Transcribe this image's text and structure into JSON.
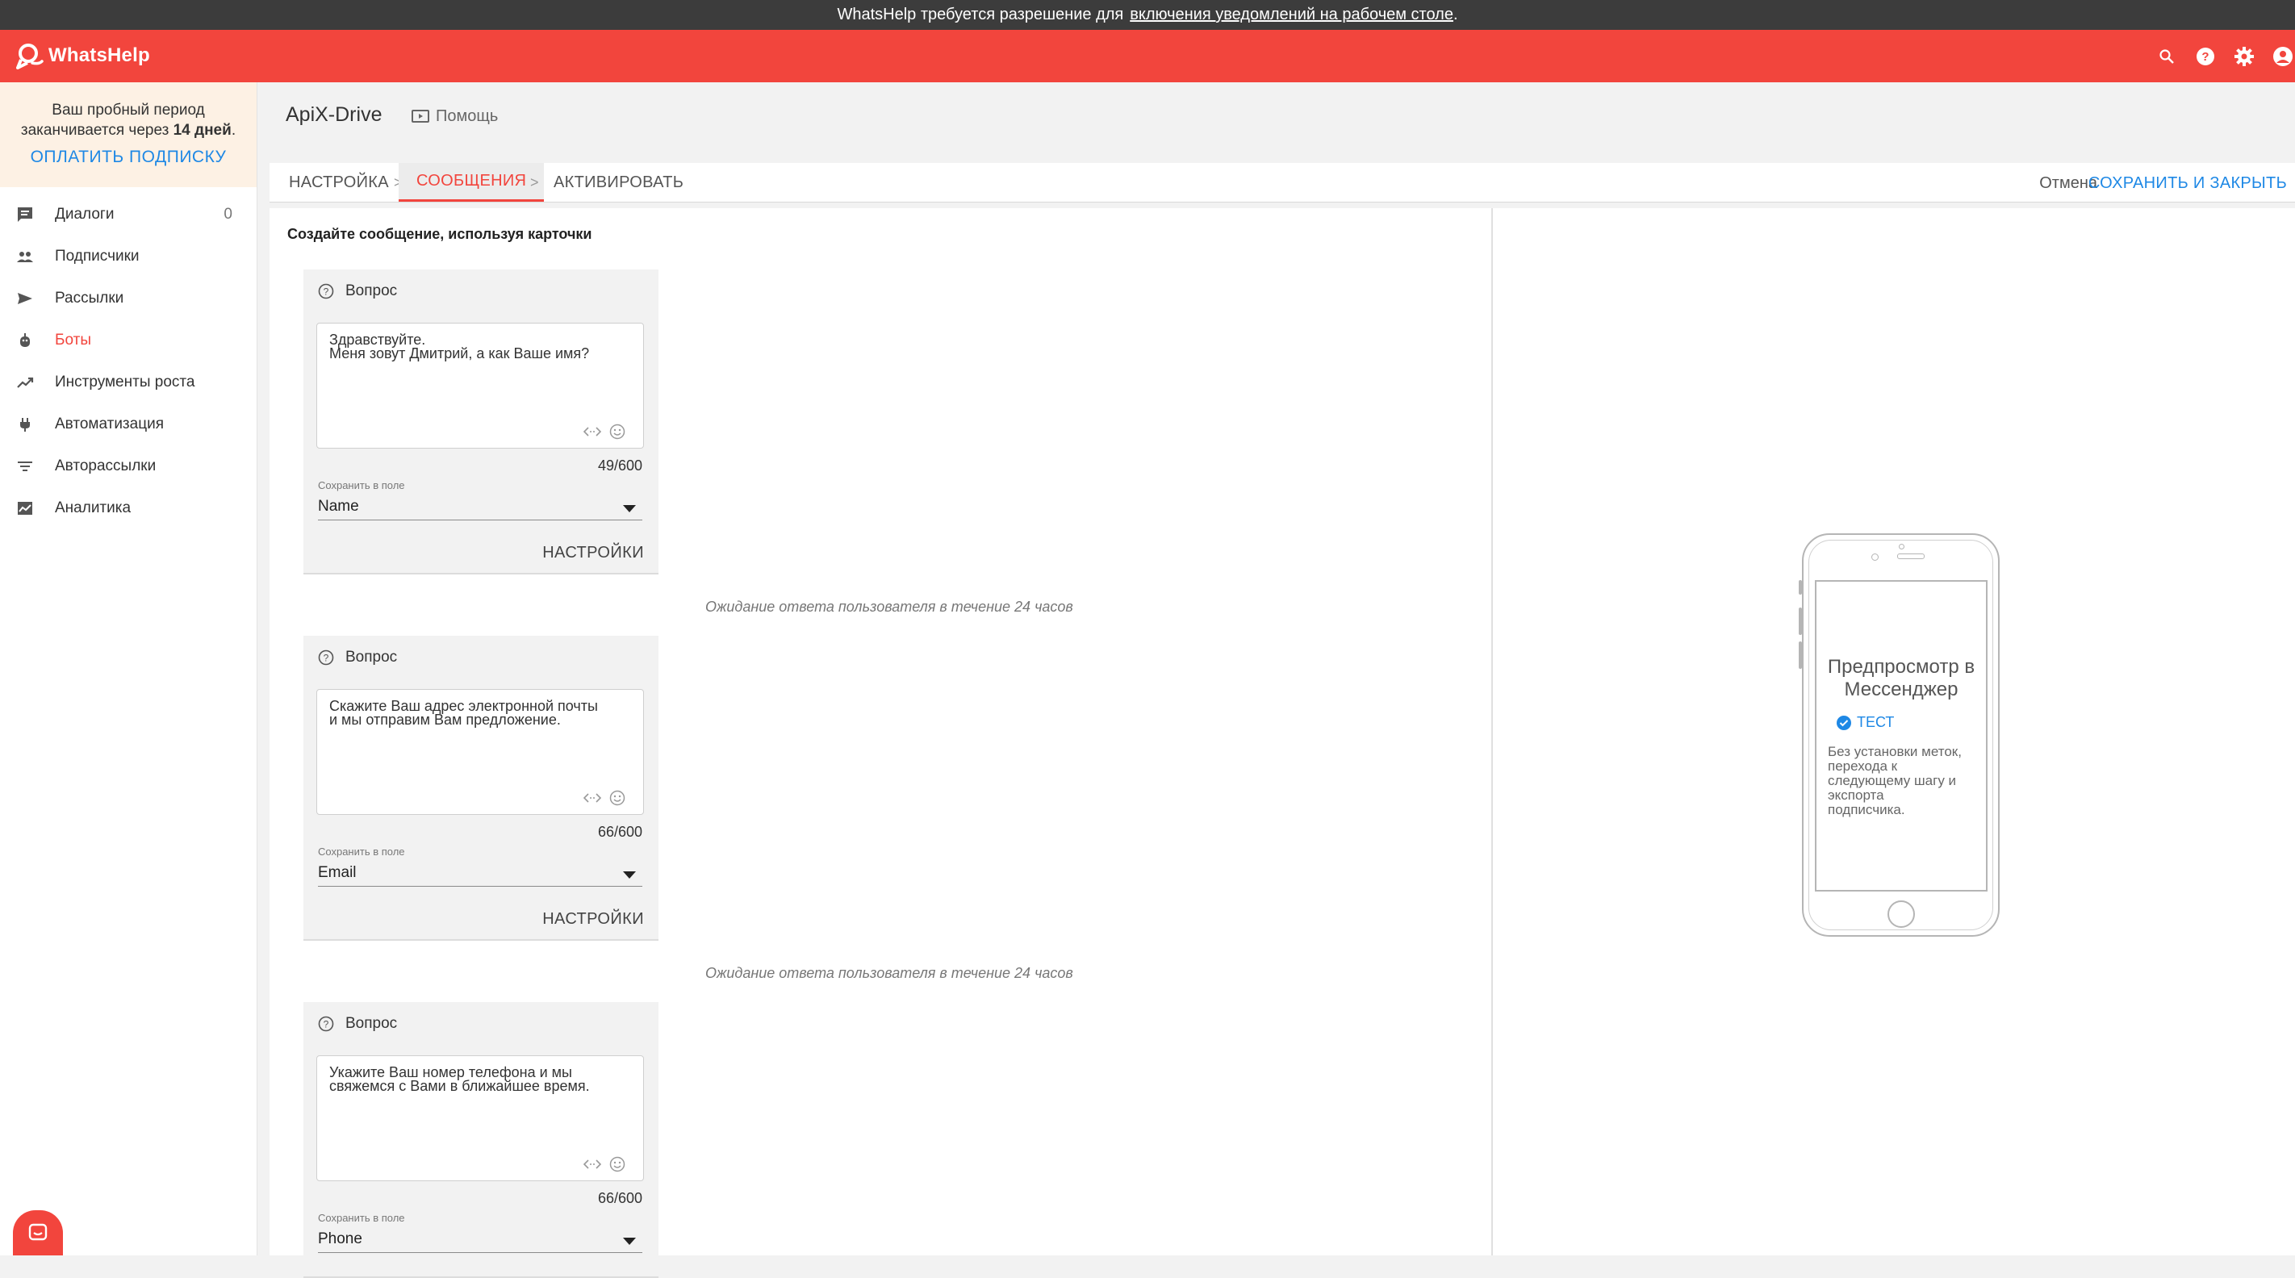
{
  "notification": {
    "text_before": "WhatsHelp требуется разрешение для",
    "link": "включения уведомлений на рабочем столе",
    "text_after": "."
  },
  "header": {
    "brand": "WhatsHelp",
    "icons": [
      "search-icon",
      "help-icon",
      "settings-icon",
      "account-icon"
    ]
  },
  "sidebar": {
    "trial_line1": "Ваш пробный период",
    "trial_line2_prefix": "заканчивается через",
    "trial_days": "14 дней",
    "trial_line2_suffix": ".",
    "pay_label": "ОПЛАТИТЬ ПОДПИСКУ",
    "items": [
      {
        "label": "Диалоги",
        "count": "0",
        "icon": "dialogs-icon"
      },
      {
        "label": "Подписчики",
        "icon": "subscribers-icon"
      },
      {
        "label": "Рассылки",
        "icon": "send-icon"
      },
      {
        "label": "Боты",
        "icon": "bot-icon",
        "active": true
      },
      {
        "label": "Инструменты роста",
        "icon": "growth-icon"
      },
      {
        "label": "Автоматизация",
        "icon": "plug-icon"
      },
      {
        "label": "Авторассылки",
        "icon": "filter-icon"
      },
      {
        "label": "Аналитика",
        "icon": "analytics-icon"
      }
    ]
  },
  "page": {
    "title": "ApiX-Drive",
    "help_label": "Помощь"
  },
  "tabs": {
    "setup": "НАСТРОЙКА",
    "messages": "СООБЩЕНИЯ",
    "activate": "АКТИВИРОВАТЬ",
    "separator": ">",
    "cancel": "Отмена",
    "save": "СОХРАНИТЬ И ЗАКРЫТЬ"
  },
  "editor": {
    "instruction": "Создайте сообщение, используя карточки",
    "cards": [
      {
        "type": "Вопрос",
        "line1": "Здравствуйте.",
        "line2": "Меня зовут Дмитрий, а как Ваше имя?",
        "counter": "49/600",
        "field_label": "Сохранить в поле",
        "field_value": "Name",
        "settings": "НАСТРОЙКИ"
      },
      {
        "type": "Вопрос",
        "line1": "Скажите Ваш адрес электронной почты",
        "line2": "и мы отправим Вам предложение.",
        "counter": "66/600",
        "field_label": "Сохранить в поле",
        "field_value": "Email",
        "settings": "НАСТРОЙКИ"
      },
      {
        "type": "Вопрос",
        "line1": "Укажите Ваш номер телефона и мы",
        "line2": "свяжемся с Вами в ближайшее время.",
        "counter": "66/600",
        "field_label": "Сохранить в поле",
        "field_value": "Phone"
      }
    ],
    "wait_text": "Ожидание ответа пользователя в течение 24 часов"
  },
  "preview": {
    "title_line1": "Предпросмотр в",
    "title_line2": "Мессенджер",
    "test_label": "ТЕСТ",
    "desc_line1": "Без установки меток,",
    "desc_line2": "перехода к",
    "desc_line3": "следующему шагу и",
    "desc_line4": "экспорта",
    "desc_line5": "подписчика."
  },
  "colors": {
    "brand": "#f2453d",
    "link": "#1e88e5",
    "notification_bg": "#3c3c3c"
  }
}
